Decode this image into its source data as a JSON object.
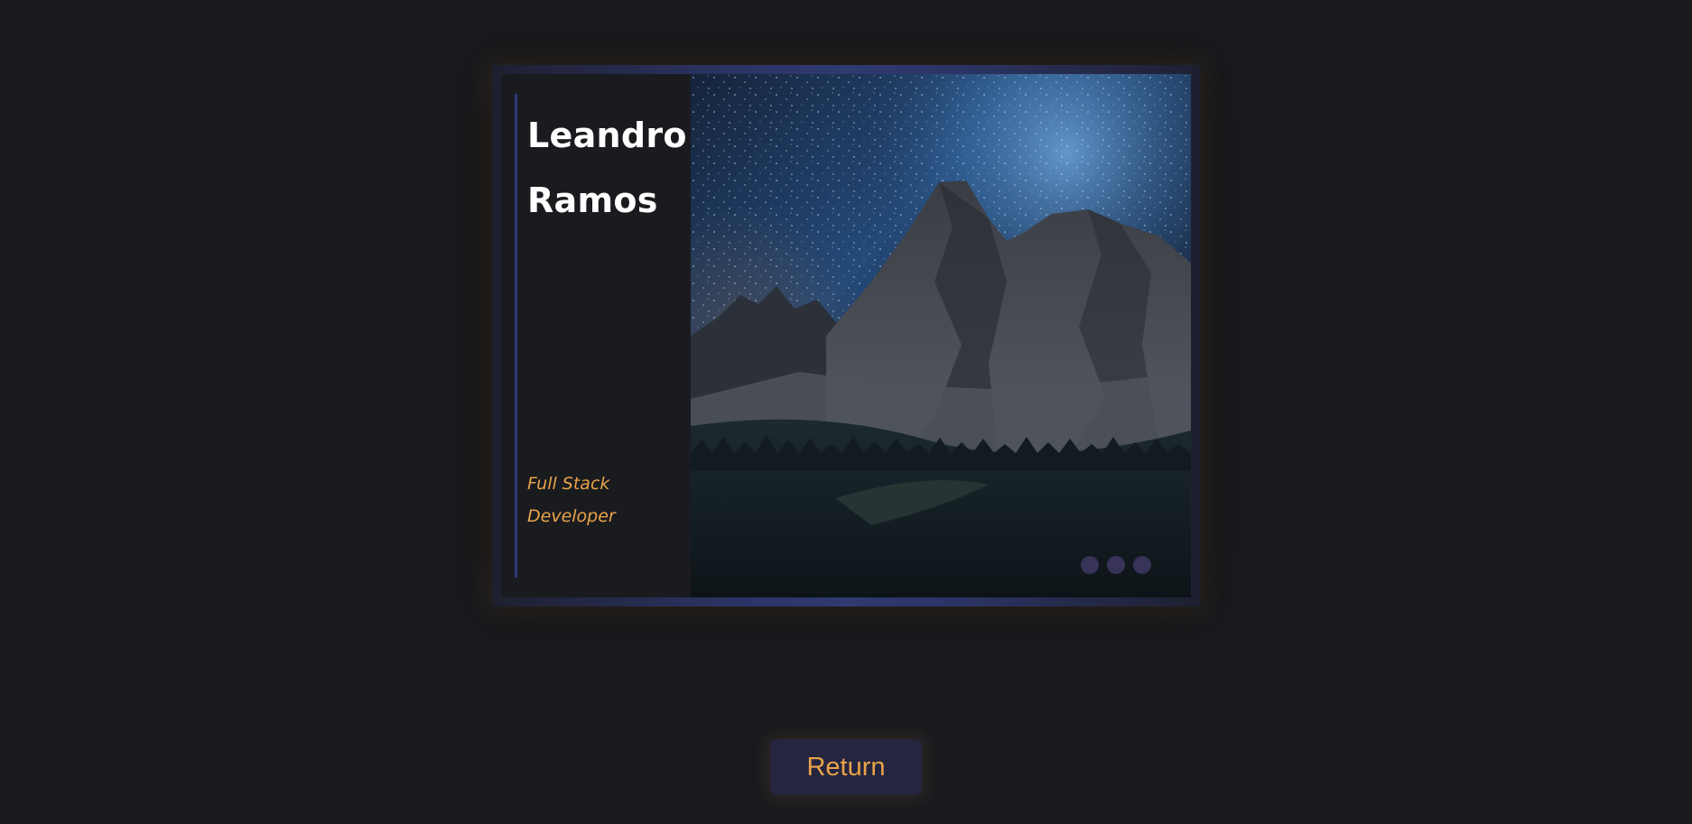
{
  "profile": {
    "first_name": "Leandro",
    "last_name": "Ramos",
    "role_line1": "Full Stack",
    "role_line2": "Developer"
  },
  "image": {
    "subject": "starry night sky over mountain peaks and forest"
  },
  "carousel": {
    "dots": 3
  },
  "actions": {
    "return_label": "Return"
  },
  "colors": {
    "background": "#1a1b1f",
    "accent_orange": "#e8a34a",
    "accent_blue": "#2d3a78",
    "button_bg": "#25253f"
  }
}
